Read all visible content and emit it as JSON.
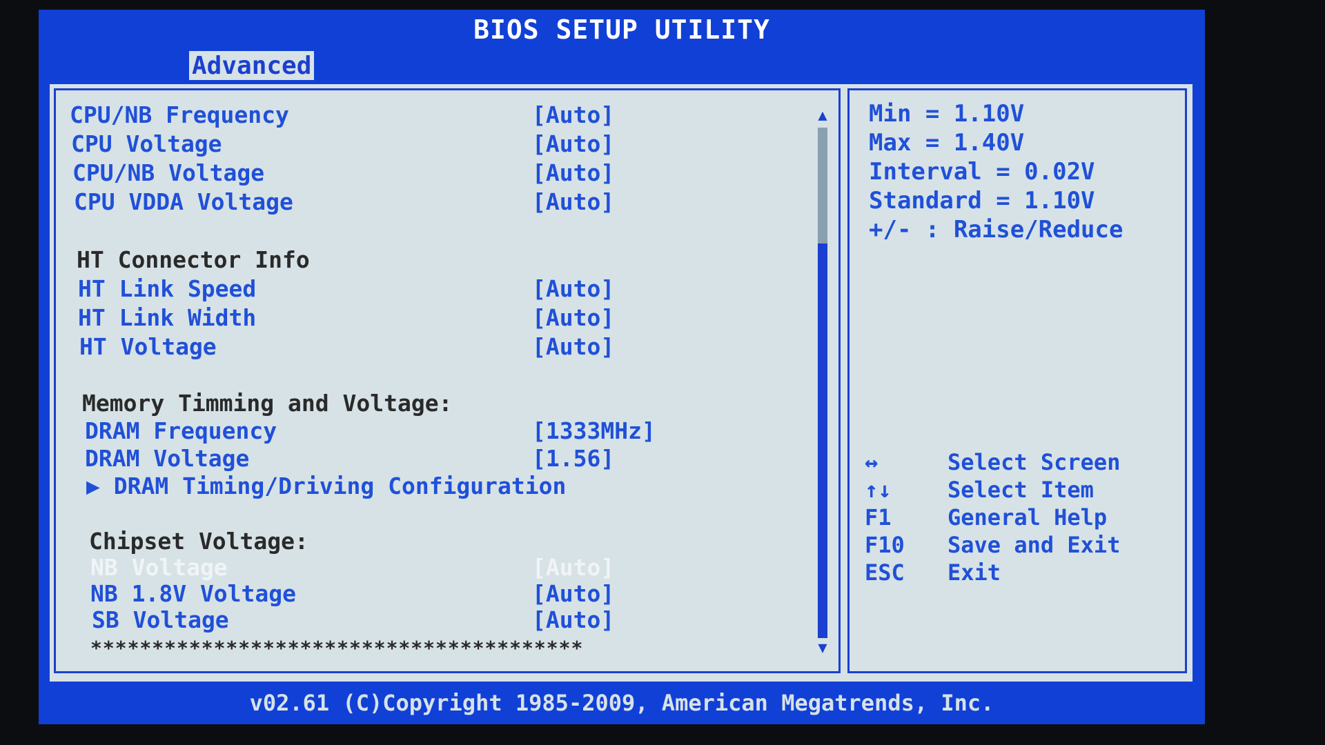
{
  "title": "BIOS SETUP UTILITY",
  "tabs": [
    {
      "label": "Advanced",
      "active": true
    }
  ],
  "settings": {
    "cpu_nb_frequency": {
      "label": "CPU/NB Frequency",
      "value": "[Auto]"
    },
    "cpu_voltage": {
      "label": "CPU Voltage",
      "value": "[Auto]"
    },
    "cpu_nb_voltage": {
      "label": "CPU/NB Voltage",
      "value": "[Auto]"
    },
    "cpu_vdda_voltage": {
      "label": "CPU VDDA Voltage",
      "value": "[Auto]"
    },
    "ht_header": "HT Connector Info",
    "ht_link_speed": {
      "label": "HT Link Speed",
      "value": "[Auto]"
    },
    "ht_link_width": {
      "label": "HT Link Width",
      "value": "[Auto]"
    },
    "ht_voltage": {
      "label": "HT Voltage",
      "value": "[Auto]"
    },
    "memory_header": "Memory Timming and Voltage:",
    "dram_frequency": {
      "label": "DRAM Frequency",
      "value": "[1333MHz]"
    },
    "dram_voltage": {
      "label": "DRAM Voltage",
      "value": "[1.56]"
    },
    "dram_timing_submenu": "▶ DRAM Timing/Driving Configuration",
    "chipset_header": "Chipset Voltage:",
    "nb_voltage": {
      "label": "NB Voltage",
      "value": "[Auto]"
    },
    "nb_18v_voltage": {
      "label": "NB 1.8V Voltage",
      "value": "[Auto]"
    },
    "sb_voltage": {
      "label": "SB Voltage",
      "value": "[Auto]"
    },
    "separator": "****************************************"
  },
  "help_panel": {
    "min": "Min = 1.10V",
    "max": "Max = 1.40V",
    "interval": "Interval = 0.02V",
    "standard": "Standard = 1.10V",
    "raise_reduce": "+/- : Raise/Reduce"
  },
  "key_legend": [
    {
      "key": "↔",
      "desc": "Select Screen"
    },
    {
      "key": "↑↓",
      "desc": "Select Item"
    },
    {
      "key": "F1",
      "desc": "General Help"
    },
    {
      "key": "F10",
      "desc": "Save and Exit"
    },
    {
      "key": "ESC",
      "desc": "Exit"
    }
  ],
  "footer": "v02.61 (C)Copyright 1985-2009, American Megatrends, Inc.",
  "scroll_position_fraction": 0.0,
  "colors": {
    "frame_blue": "#1140d6",
    "panel_bg": "#d7e2e6",
    "item_blue": "#2050d8",
    "header_text": "#2a2a2a",
    "selected_text": "#f0f4f6"
  }
}
